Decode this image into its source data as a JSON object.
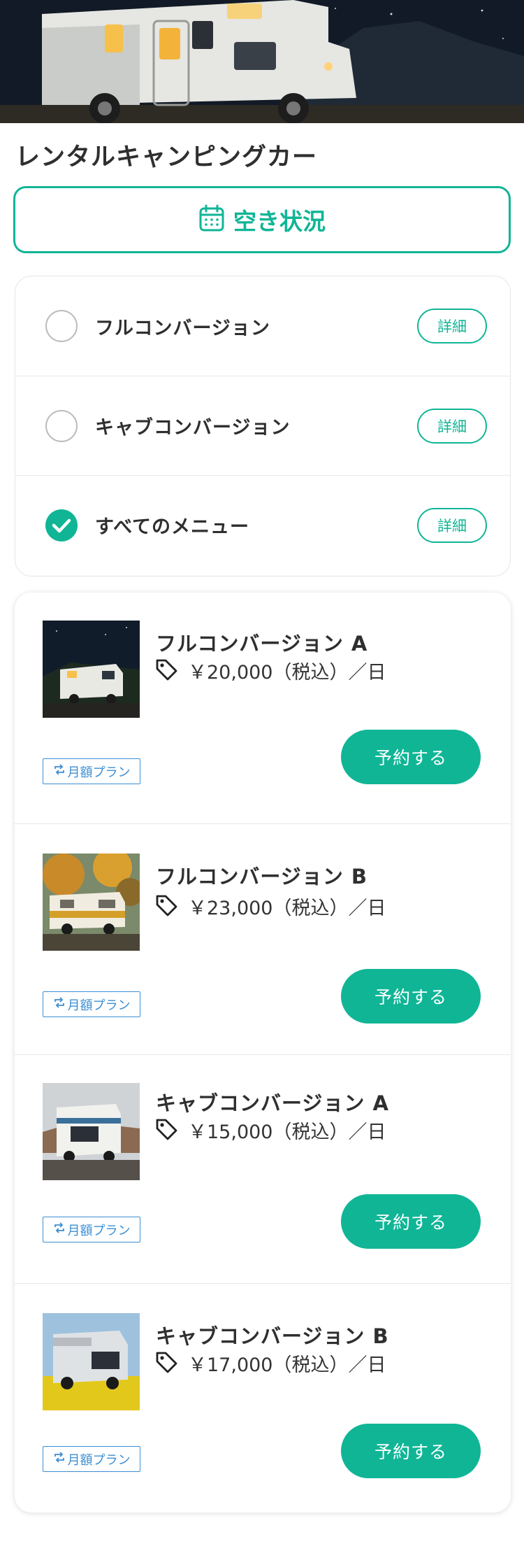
{
  "hero": {
    "image": "camper-van-at-night-photo"
  },
  "page": {
    "title": "レンタルキャンピングカー"
  },
  "availability": {
    "label": "空き状況",
    "icon": "calendar-icon"
  },
  "menu": {
    "options": [
      {
        "label": "フルコンバージョン",
        "checked": false,
        "detail_label": "詳細"
      },
      {
        "label": "キャブコンバージョン",
        "checked": false,
        "detail_label": "詳細"
      },
      {
        "label": "すべてのメニュー",
        "checked": true,
        "detail_label": "詳細"
      }
    ]
  },
  "plans": [
    {
      "name": "フルコンバージョン A",
      "price": "￥20,000（税込）／日",
      "badge": "月額プラン",
      "button": "予約する",
      "thumb": "night-camper-photo"
    },
    {
      "name": "フルコンバージョン B",
      "price": "￥23,000（税込）／日",
      "badge": "月額プラン",
      "button": "予約する",
      "thumb": "vintage-camper-autumn-photo"
    },
    {
      "name": "キャブコンバージョン A",
      "price": "￥15,000（税込）／日",
      "badge": "月額プラン",
      "button": "予約する",
      "thumb": "cab-camper-road-photo"
    },
    {
      "name": "キャブコンバージョン B",
      "price": "￥17,000（税込）／日",
      "badge": "月額プラン",
      "button": "予約する",
      "thumb": "silver-camper-flowers-photo"
    }
  ],
  "colors": {
    "accent": "#10b596",
    "badge": "#3b8fd4",
    "text": "#2f2f2f"
  }
}
